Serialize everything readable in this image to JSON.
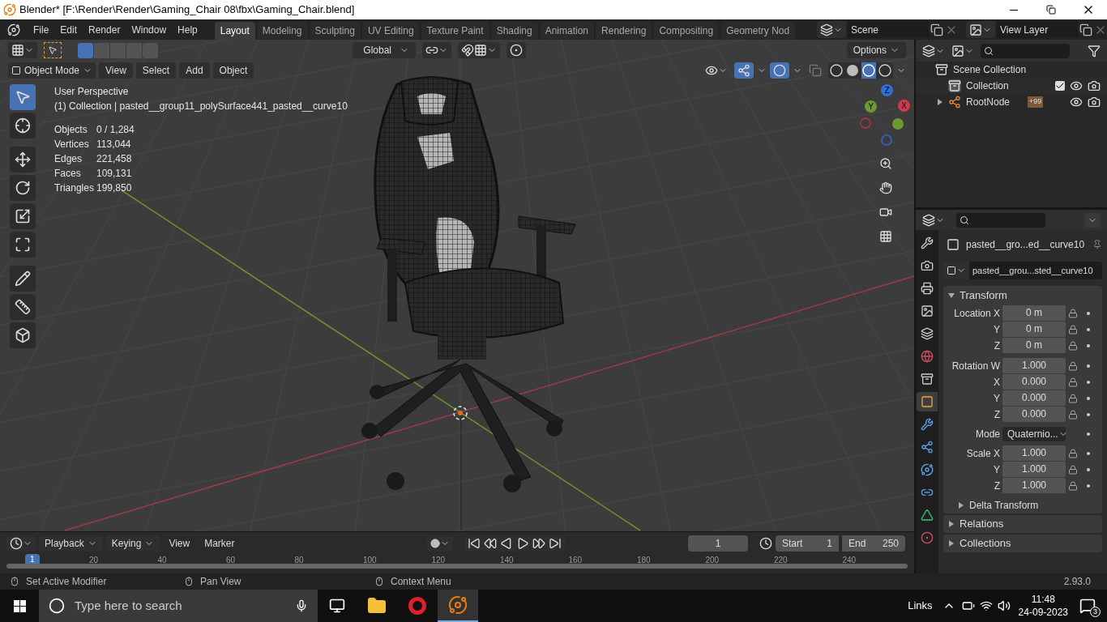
{
  "title_bar": {
    "title": "Blender* [F:\\Render\\Render\\Gaming_Chair 08\\fbx\\Gaming_Chair.blend]"
  },
  "menu": [
    "File",
    "Edit",
    "Render",
    "Window",
    "Help"
  ],
  "workspaces": [
    {
      "label": "Layout",
      "selected": true
    },
    {
      "label": "Modeling",
      "selected": false
    },
    {
      "label": "Sculpting",
      "selected": false
    },
    {
      "label": "UV Editing",
      "selected": false
    },
    {
      "label": "Texture Paint",
      "selected": false
    },
    {
      "label": "Shading",
      "selected": false
    },
    {
      "label": "Animation",
      "selected": false
    },
    {
      "label": "Rendering",
      "selected": false
    },
    {
      "label": "Compositing",
      "selected": false
    },
    {
      "label": "Geometry Nod",
      "selected": false
    }
  ],
  "scene": "Scene",
  "view_layer": "View Layer",
  "tool_header": {
    "orientation": "Global",
    "options": "Options"
  },
  "viewport_header": {
    "mode": "Object Mode",
    "menus": [
      "View",
      "Select",
      "Add",
      "Object"
    ]
  },
  "viewport": {
    "view_name": "User Perspective",
    "active": "(1) Collection | pasted__group11_polySurface441_pasted__curve10",
    "stats": [
      {
        "label": "Objects",
        "value": "0 / 1,284"
      },
      {
        "label": "Vertices",
        "value": "113,044"
      },
      {
        "label": "Edges",
        "value": "221,458"
      },
      {
        "label": "Faces",
        "value": "109,131"
      },
      {
        "label": "Triangles",
        "value": "199,850"
      }
    ],
    "gizmo": [
      {
        "label": "Z",
        "color": "#2f6fd6"
      },
      {
        "label": "Y",
        "color": "#6b9b2e"
      },
      {
        "label": "X",
        "color": "#d0394f"
      }
    ]
  },
  "outliner": {
    "root": "Scene Collection",
    "items": [
      {
        "label": "Collection",
        "kind": "collection",
        "checked": true
      },
      {
        "label": "RootNode",
        "kind": "empty",
        "expanded": false,
        "badge": "+99"
      }
    ]
  },
  "property_tabs": [
    {
      "kind": "tool",
      "selected": false
    },
    {
      "kind": "render",
      "selected": false
    },
    {
      "kind": "output",
      "selected": false
    },
    {
      "kind": "view_layer",
      "selected": false
    },
    {
      "kind": "scene",
      "selected": false
    },
    {
      "kind": "world",
      "selected": false
    },
    {
      "kind": "collection",
      "selected": false
    },
    {
      "kind": "object",
      "selected": true
    },
    {
      "kind": "modifier",
      "selected": false
    },
    {
      "kind": "particles",
      "selected": false
    },
    {
      "kind": "physics",
      "selected": false
    },
    {
      "kind": "constraints",
      "selected": false
    },
    {
      "kind": "data",
      "selected": false
    },
    {
      "kind": "material",
      "selected": false
    }
  ],
  "properties": {
    "object_name": "pasted__gro...ed__curve10",
    "data_name": "pasted__grou...sted__curve10",
    "transform": {
      "title": "Transform",
      "expanded": true,
      "rows": [
        {
          "label": "Location X",
          "value": "0 m",
          "kind": "number"
        },
        {
          "label": "Y",
          "value": "0 m",
          "kind": "number"
        },
        {
          "label": "Z",
          "value": "0 m",
          "kind": "number"
        },
        {
          "label": "Rotation W",
          "value": "1.000",
          "kind": "number"
        },
        {
          "label": "X",
          "value": "0.000",
          "kind": "number"
        },
        {
          "label": "Y",
          "value": "0.000",
          "kind": "number"
        },
        {
          "label": "Z",
          "value": "0.000",
          "kind": "number"
        },
        {
          "label": "Mode",
          "value": "Quaternio...",
          "kind": "dropdown"
        },
        {
          "label": "Scale X",
          "value": "1.000",
          "kind": "number"
        },
        {
          "label": "Y",
          "value": "1.000",
          "kind": "number"
        },
        {
          "label": "Z",
          "value": "1.000",
          "kind": "number"
        }
      ],
      "subpanel": {
        "title": "Delta Transform",
        "expanded": false
      }
    },
    "panels": [
      {
        "title": "Relations",
        "expanded": false
      },
      {
        "title": "Collections",
        "expanded": false
      }
    ]
  },
  "timeline": {
    "menus": [
      "Playback",
      "Keying",
      "View",
      "Marker"
    ],
    "current_frame": "1",
    "start_label": "Start",
    "start": "1",
    "end_label": "End",
    "end": "250",
    "ruler_current": "1",
    "ruler": [
      "20",
      "40",
      "60",
      "80",
      "100",
      "120",
      "140",
      "160",
      "180",
      "200",
      "220",
      "240"
    ]
  },
  "status_bar": {
    "hints": [
      "Set Active Modifier",
      "Pan View",
      "Context Menu"
    ],
    "version": "2.93.0"
  },
  "taskbar": {
    "search_placeholder": "Type here to search",
    "apps": [
      {
        "kind": "explorer",
        "selected": false
      },
      {
        "kind": "opera",
        "selected": false
      },
      {
        "kind": "blender",
        "selected": true
      }
    ],
    "links": "Links",
    "time": "11:48",
    "date": "24-09-2023",
    "notifications": "3"
  }
}
